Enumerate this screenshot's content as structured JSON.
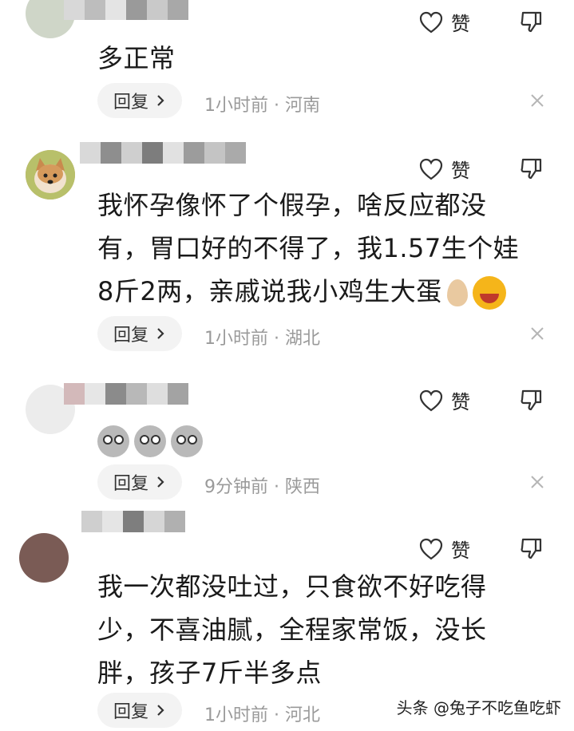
{
  "comments": [
    {
      "text": "多正常",
      "like_label": "赞",
      "reply_label": "回复",
      "meta": "1小时前 · 河南"
    },
    {
      "text": "我怀孕像怀了个假孕，啥反应都没有，胃口好的不得了，我1.57生个娃8斤2两，亲戚说我小鸡生大蛋",
      "like_label": "赞",
      "reply_label": "回复",
      "meta": "1小时前 · 湖北"
    },
    {
      "text": "",
      "like_label": "赞",
      "reply_label": "回复",
      "meta": "9分钟前 · 陕西"
    },
    {
      "text": "我一次都没吐过，只食欲不好吃得少，不喜油腻，全程家常饭，没长胖，孩子7斤半多点",
      "like_label": "赞",
      "reply_label": "回复",
      "meta": "1小时前 · 河北"
    }
  ],
  "watermark": "头条 @兔子不吃鱼吃虾",
  "icons": {
    "like": "heart-outline-icon",
    "dislike": "thumbs-down-icon",
    "close": "close-icon",
    "chevron": "chevron-right-icon"
  },
  "colors": {
    "reply_bg": "#f3f3f3",
    "meta": "#9a9a9a",
    "text": "#1a1a1a"
  }
}
